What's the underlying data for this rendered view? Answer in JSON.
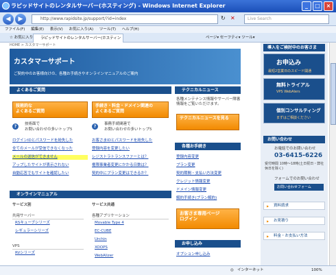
{
  "window": {
    "title": "ラピッドサイトのレンタルサーバー(ホスティング) - Windows Internet Explorer"
  },
  "address": {
    "url": "http://www.rapidsite.jp/support/?id=index",
    "search_placeholder": "Live Search"
  },
  "menu": [
    "ファイル(F)",
    "編集(E)",
    "表示(V)",
    "お気に入り(A)",
    "ツール(T)",
    "ヘルプ(H)"
  ],
  "tabs": {
    "favorites": "お気に入り",
    "active": "ラピッドサイトのレンタルサーバー(ホスティング)",
    "tools": "ページ▾  セーフティ▾  ツール▾"
  },
  "page": {
    "crumb": "HOME > カスタマーサポート",
    "hero_title": "カスタマーサポート",
    "hero_sub": "ご契約中のお客様向けの、各種お手続きやオンラインマニュアルのご案内",
    "faq": {
      "header": "よくあるご質問",
      "btn1": "技術的な\nよくあるご質問",
      "btn2": "手続き・料金・ドメイン関連の\nよくあるご質問",
      "desc1a": "技術面で",
      "desc1b": "お問い合わせの多いトップ5",
      "desc2a": "事務手続関連で",
      "desc2b": "お問い合わせの多いトップ5",
      "links1": [
        "ログインIDとパスワードを紛失した",
        "全てのメールが受信できなくなった",
        "メールの送信ができません",
        "アップしたサイトが表示されない",
        "自動応答でもサイトを確認したい"
      ],
      "links2": [
        "お客さまIDとパスワードを紛失した",
        "登録内容を変更したい",
        "レジストラトランスファーとは？",
        "権限事業者変更にかかる日数は？",
        "契約中にプラン変更はできるか？"
      ]
    },
    "tech": {
      "header": "テクニカルニュース",
      "text": "各種メンテナンス情報やサーバー障害情報をご覧いただけます。",
      "btn": "テクニカルニュースを見る"
    },
    "proc": {
      "header": "各種お手続き",
      "links": [
        "登録内容変更",
        "プラン変更",
        "契約期間・支払い方法変更",
        "クレジット情報変更",
        "ドメイン情報変更",
        "解約手続き(プラン解約)"
      ],
      "btn": "お客さま専用ページ\nログイン"
    },
    "manual": {
      "header": "オンラインマニュアル",
      "col1_title": "サービス別",
      "col1_sub": "共用サーバー",
      "col1_links": [
        "RSキューブシリーズ",
        "レギュラーシリーズ"
      ],
      "col1_sub2": "VPS",
      "col1_links2": [
        "RVシリーズ"
      ],
      "col2_title": "サービス共通",
      "col2_sub": "各種アプリケーション",
      "col2_links": [
        "Movable Type 4",
        "EC-CUBE",
        "Urchin",
        "XOOPS",
        "WebAlizer"
      ]
    },
    "apply": {
      "header": "お申し込み",
      "link": "オプション申し込み"
    },
    "right": {
      "top": "導入をご検討中のお客さま",
      "apply": "お申込み",
      "apply_sub": "最短2営業日のスピード開通",
      "trial": "無料トライアル",
      "trial_sub": "VPS WebAlers",
      "consult": "個別コンサルティング",
      "consult_sub": "まずはご相談ください",
      "contact_header": "お問い合わせ",
      "phone_label": "お電話でのお問い合わせ",
      "phone": "03-6415-6226",
      "hours": "受付時間 10時〜18時(土日祝日・弊社休日を除く)",
      "form_label": "フォームでのお問い合わせ",
      "form_btn": "お問い合わせフォーム",
      "btns": [
        "資料請求",
        "お見積り",
        "料金・お支払い方法"
      ]
    }
  },
  "status": {
    "zone": "インターネット",
    "zoom": "100%"
  }
}
